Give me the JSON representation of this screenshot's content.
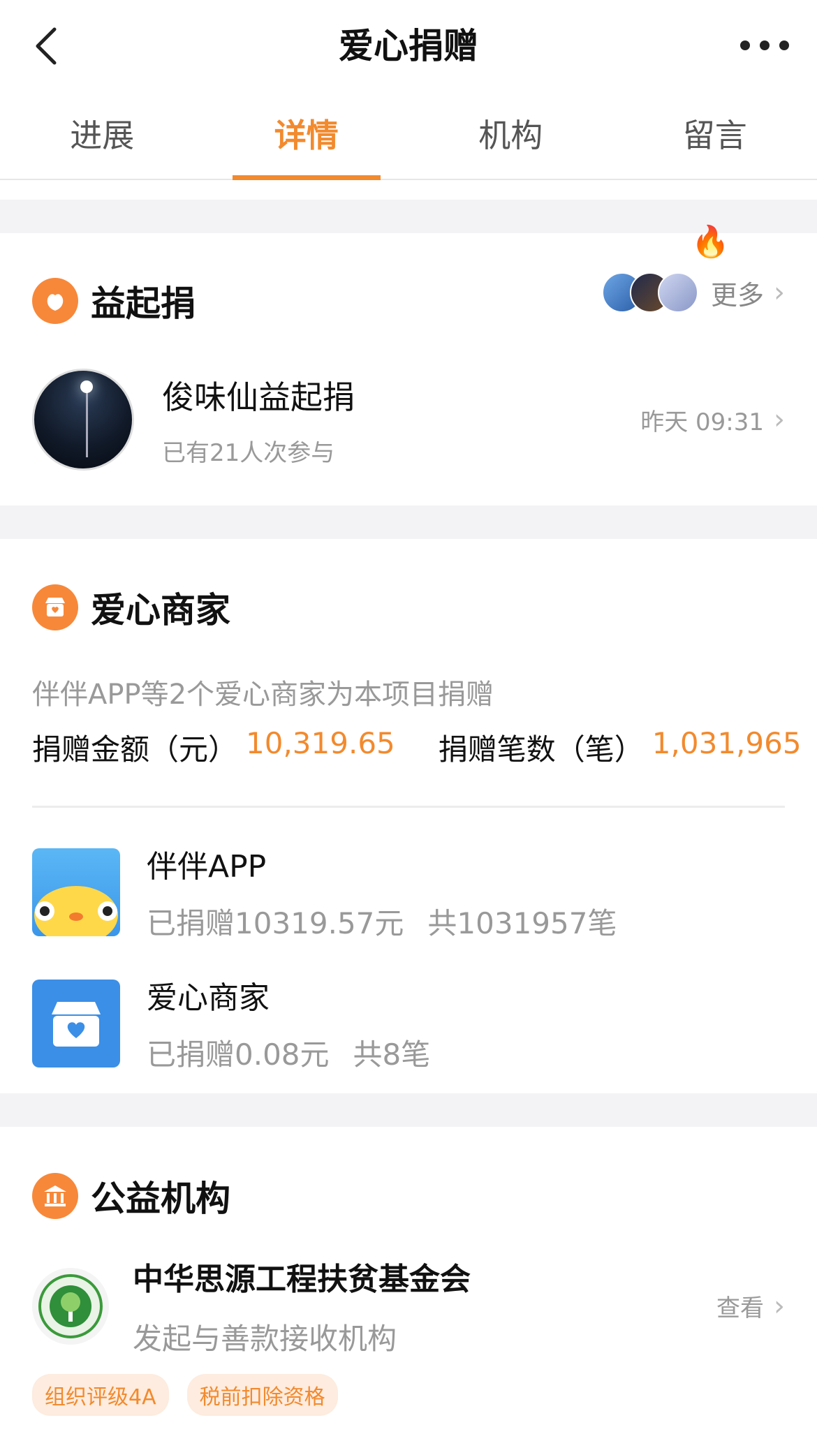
{
  "nav": {
    "title": "爱心捐赠"
  },
  "tabs": [
    {
      "label": "进展",
      "active": false
    },
    {
      "label": "详情",
      "active": true
    },
    {
      "label": "机构",
      "active": false
    },
    {
      "label": "留言",
      "active": false
    }
  ],
  "yiqijuan": {
    "title": "益起捐",
    "more_label": "更多",
    "item": {
      "name": "俊味仙益起捐",
      "participants": "已有21人次参与",
      "time": "昨天 09:31"
    }
  },
  "merchants": {
    "title": "爱心商家",
    "description": "伴伴APP等2个爱心商家为本项目捐赠",
    "amount_label": "捐赠金额（元）",
    "amount_value": "10,319.65",
    "count_label": "捐赠笔数（笔）",
    "count_value": "1,031,965",
    "list": [
      {
        "name": "伴伴APP",
        "donated": "已捐赠10319.57元",
        "count": "共1031957笔"
      },
      {
        "name": "爱心商家",
        "donated": "已捐赠0.08元",
        "count": "共8笔"
      }
    ]
  },
  "organization": {
    "title": "公益机构",
    "name": "中华思源工程扶贫基金会",
    "role": "发起与善款接收机构",
    "view_label": "查看",
    "badges": [
      "组织评级4A",
      "税前扣除资格"
    ]
  },
  "colors": {
    "accent": "#f28a2e",
    "icon_bg": "#f7883a",
    "gap_bg": "#f3f3f5"
  }
}
